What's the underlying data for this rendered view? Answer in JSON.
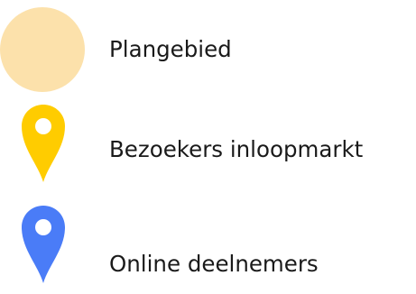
{
  "legend": {
    "items": [
      {
        "key": "area",
        "symbol": "filled-circle",
        "color": "#FCE1AB",
        "label": "Plangebied"
      },
      {
        "key": "visitors",
        "symbol": "map-pin",
        "color": "#FFCC00",
        "label": "Bezoekers inloopmarkt"
      },
      {
        "key": "online",
        "symbol": "map-pin",
        "color": "#4A7CF7",
        "label": "Online deelnemers"
      }
    ]
  }
}
